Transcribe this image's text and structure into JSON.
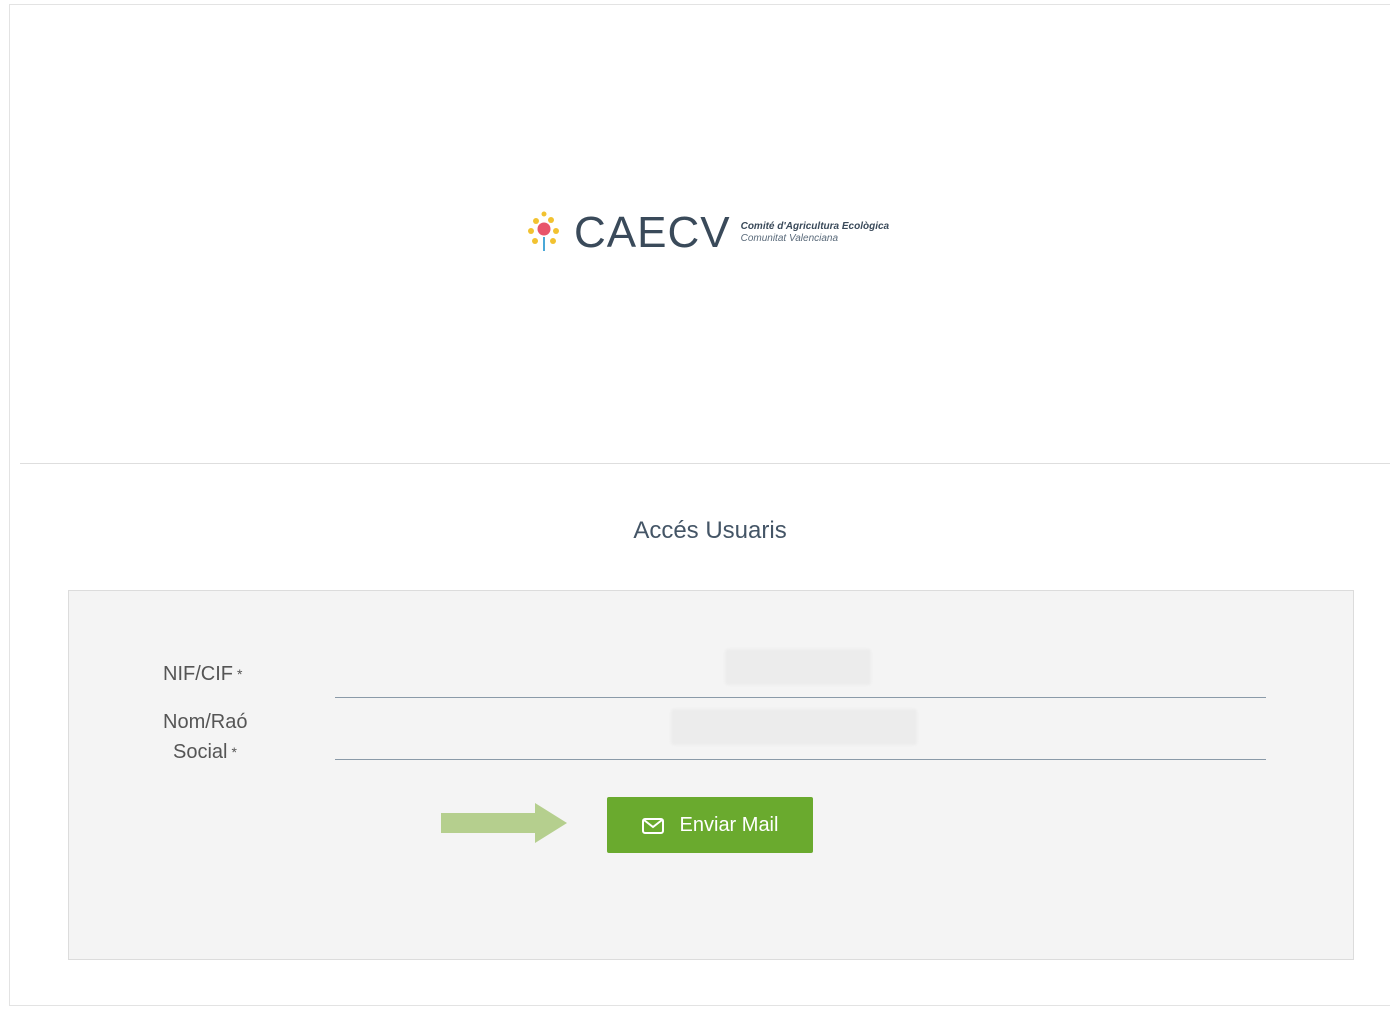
{
  "logo": {
    "brand": "CAECV",
    "line1": "Comité d'Agricultura Ecològica",
    "line2": "Comunitat Valenciana",
    "colors": {
      "pink": "#e8556b",
      "yellow": "#f2c230",
      "blue": "#4aa8d8",
      "text": "#3a4a5a"
    }
  },
  "login": {
    "title": "Accés Usuaris",
    "fields": [
      {
        "label": "NIF/CIF",
        "required_mark": "*",
        "value": ""
      },
      {
        "label_line1": "Nom/Raó",
        "label_line2": "Social",
        "required_mark": "*",
        "value": ""
      }
    ],
    "submit": {
      "label": "Enviar Mail",
      "icon": "envelope-icon",
      "color": "#6aaa2e"
    },
    "pointer": {
      "icon": "arrow-right-icon",
      "color": "#b5cf8e"
    }
  }
}
